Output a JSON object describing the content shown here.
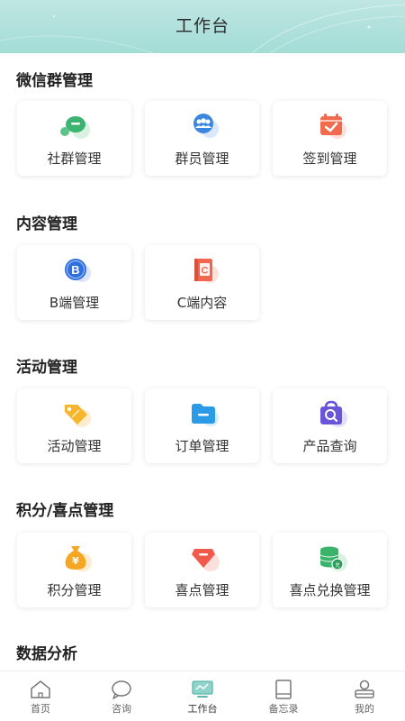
{
  "header": {
    "title": "工作台"
  },
  "sections": [
    {
      "title": "微信群管理",
      "items": [
        {
          "label": "社群管理",
          "icon": "chat-bubbles-icon",
          "color": "#3cb371"
        },
        {
          "label": "群员管理",
          "icon": "group-members-icon",
          "color": "#3a86e0"
        },
        {
          "label": "签到管理",
          "icon": "calendar-check-icon",
          "color": "#f06a4d"
        }
      ]
    },
    {
      "title": "内容管理",
      "items": [
        {
          "label": "B端管理",
          "icon": "b-badge-icon",
          "color": "#2f6fe0"
        },
        {
          "label": "C端内容",
          "icon": "c-book-icon",
          "color": "#f0674f"
        }
      ]
    },
    {
      "title": "活动管理",
      "items": [
        {
          "label": "活动管理",
          "icon": "tag-icon",
          "color": "#f5b62b"
        },
        {
          "label": "订单管理",
          "icon": "folder-icon",
          "color": "#2b9be8"
        },
        {
          "label": "产品查询",
          "icon": "bag-search-icon",
          "color": "#6a55d8"
        }
      ]
    },
    {
      "title": "积分/喜点管理",
      "items": [
        {
          "label": "积分管理",
          "icon": "money-bag-icon",
          "color": "#f5a623"
        },
        {
          "label": "喜点管理",
          "icon": "gem-icon",
          "color": "#ef5a4a"
        },
        {
          "label": "喜点兑换管理",
          "icon": "database-exchange-icon",
          "color": "#3bb36a"
        }
      ]
    },
    {
      "title": "数据分析",
      "items": []
    }
  ],
  "tabbar": {
    "items": [
      {
        "label": "首页",
        "icon": "home-icon"
      },
      {
        "label": "咨询",
        "icon": "chat-icon"
      },
      {
        "label": "工作台",
        "icon": "workbench-icon",
        "active": true
      },
      {
        "label": "备忘录",
        "icon": "memo-icon"
      },
      {
        "label": "我的",
        "icon": "profile-icon"
      }
    ]
  }
}
